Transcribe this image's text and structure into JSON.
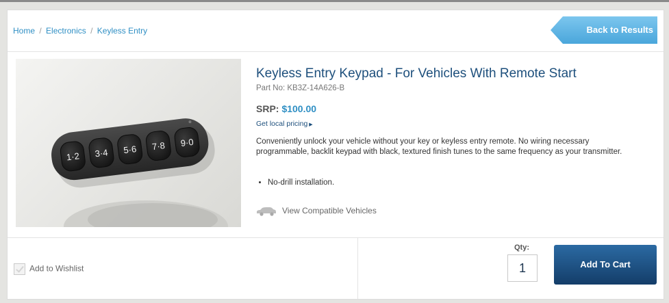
{
  "breadcrumb": {
    "items": [
      "Home",
      "Electronics",
      "Keyless Entry"
    ],
    "separator": "/"
  },
  "back_button_label": "Back to Results",
  "product": {
    "title": "Keyless Entry Keypad - For Vehicles With Remote Start",
    "part_no": "Part No: KB3Z-14A626-B",
    "srp_label": "SRP:",
    "srp_price": "$100.00",
    "local_pricing_label": "Get local pricing",
    "description": "Conveniently unlock your vehicle without your key or keyless entry remote. No wiring necessary programmable, backlit keypad with black, textured finish tunes to the same frequency as your transmitter.",
    "bullets": [
      "No-drill installation."
    ],
    "compatible_link": "View Compatible Vehicles",
    "keypad_buttons": [
      "1·2",
      "3·4",
      "5·6",
      "7·8",
      "9·0"
    ]
  },
  "wishlist_label": "Add to Wishlist",
  "qty": {
    "label": "Qty:",
    "value": "1"
  },
  "cart_button_label": "Add To Cart",
  "colors": {
    "link_blue": "#2f8fc4",
    "title_blue": "#1d4f7c",
    "back_button": "#5fb4e4",
    "cart_button": "#1f5489"
  },
  "icons": {
    "back_arrow": "arrow-left-icon",
    "car": "car-icon",
    "wishlist_checkbox": "checkbox-icon",
    "pricing_triangle": "triangle-right-icon"
  }
}
